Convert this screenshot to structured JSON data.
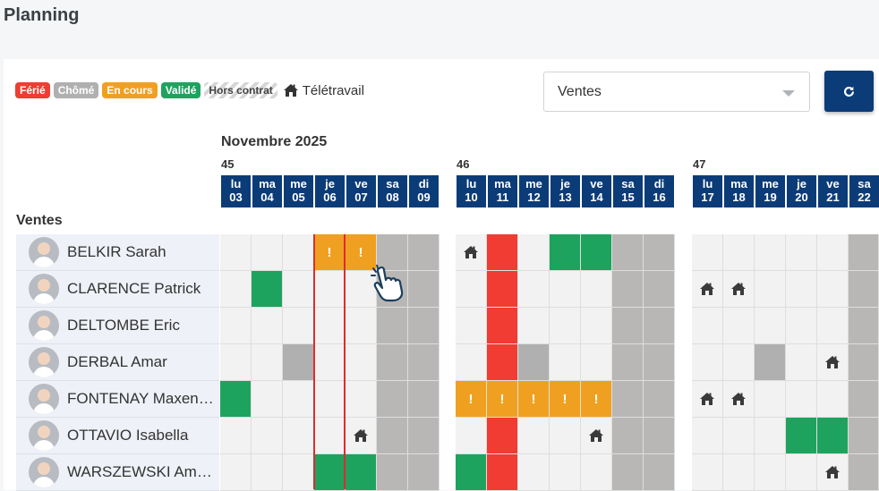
{
  "page": {
    "title": "Planning"
  },
  "legend": [
    {
      "label": "Férié",
      "color": "#f03c32",
      "style": "solid"
    },
    {
      "label": "Chômé",
      "color": "#b0b0b0",
      "style": "solid"
    },
    {
      "label": "En cours",
      "color": "#f0a020",
      "style": "solid"
    },
    {
      "label": "Validé",
      "color": "#1ea35f",
      "style": "solid"
    },
    {
      "label": "Hors contrat",
      "color": "#d6d6d6",
      "style": "hatched"
    }
  ],
  "legend_telework": {
    "label": "Télétravail",
    "icon": "home-icon"
  },
  "filter": {
    "selected": "Ventes"
  },
  "refresh": {
    "icon": "refresh-icon"
  },
  "colors": {
    "ferie": "#f03c32",
    "chome": "#b0b0b0",
    "encours": "#f0a020",
    "valide": "#1ea35f",
    "empty": "#f2f2f2",
    "weekend": "#b9b7b6",
    "header": "#0c3c78",
    "today": "#e02b2b"
  },
  "calendar": {
    "month": "Novembre 2025",
    "team": "Ventes",
    "weeks": [
      {
        "number": "45",
        "days": [
          {
            "dow": "lu",
            "num": "03"
          },
          {
            "dow": "ma",
            "num": "04"
          },
          {
            "dow": "me",
            "num": "05"
          },
          {
            "dow": "je",
            "num": "06"
          },
          {
            "dow": "ve",
            "num": "07"
          },
          {
            "dow": "sa",
            "num": "08"
          },
          {
            "dow": "di",
            "num": "09"
          }
        ]
      },
      {
        "number": "46",
        "days": [
          {
            "dow": "lu",
            "num": "10"
          },
          {
            "dow": "ma",
            "num": "11"
          },
          {
            "dow": "me",
            "num": "12"
          },
          {
            "dow": "je",
            "num": "13"
          },
          {
            "dow": "ve",
            "num": "14"
          },
          {
            "dow": "sa",
            "num": "15"
          },
          {
            "dow": "di",
            "num": "16"
          }
        ]
      },
      {
        "number": "47",
        "days": [
          {
            "dow": "lu",
            "num": "17"
          },
          {
            "dow": "ma",
            "num": "18"
          },
          {
            "dow": "me",
            "num": "19"
          },
          {
            "dow": "je",
            "num": "20"
          },
          {
            "dow": "ve",
            "num": "21"
          },
          {
            "dow": "sa",
            "num": "22"
          }
        ]
      }
    ],
    "employees": [
      {
        "name": "BELKIR Sarah",
        "cells": [
          "",
          "",
          "",
          "encours!",
          "encours!",
          "w",
          "w",
          "home",
          "ferie",
          "",
          "valide",
          "valide",
          "w",
          "w",
          "",
          "",
          "",
          "",
          "",
          "w"
        ]
      },
      {
        "name": "CLARENCE Patrick",
        "cells": [
          "",
          "valide",
          "",
          "",
          "",
          "w",
          "w",
          "",
          "ferie",
          "",
          "",
          "",
          "w",
          "w",
          "home",
          "home",
          "",
          "",
          "",
          "w"
        ]
      },
      {
        "name": "DELTOMBE Eric",
        "cells": [
          "",
          "",
          "",
          "",
          "",
          "w",
          "w",
          "",
          "ferie",
          "",
          "",
          "",
          "w",
          "w",
          "",
          "",
          "",
          "",
          "",
          "w"
        ]
      },
      {
        "name": "DERBAL Amar",
        "cells": [
          "",
          "",
          "chome",
          "",
          "",
          "w",
          "w",
          "",
          "ferie",
          "chome",
          "",
          "",
          "w",
          "w",
          "",
          "",
          "chome",
          "",
          "home",
          "w"
        ]
      },
      {
        "name": "FONTENAY Maxen…",
        "cells": [
          "valide",
          "",
          "",
          "",
          "",
          "w",
          "w",
          "encours!",
          "encours!",
          "encours!",
          "encours!",
          "encours!",
          "w",
          "w",
          "home",
          "home",
          "",
          "",
          "",
          "w"
        ]
      },
      {
        "name": "OTTAVIO Isabella",
        "cells": [
          "",
          "",
          "",
          "",
          "home",
          "w",
          "w",
          "",
          "ferie",
          "",
          "",
          "home",
          "w",
          "w",
          "",
          "",
          "",
          "valide",
          "valide",
          "w"
        ]
      },
      {
        "name": "WARSZEWSKI Am…",
        "cells": [
          "",
          "",
          "",
          "valide",
          "valide",
          "w",
          "w",
          "valide",
          "ferie",
          "",
          "",
          "",
          "w",
          "w",
          "",
          "",
          "",
          "",
          "home",
          "w"
        ]
      }
    ]
  }
}
